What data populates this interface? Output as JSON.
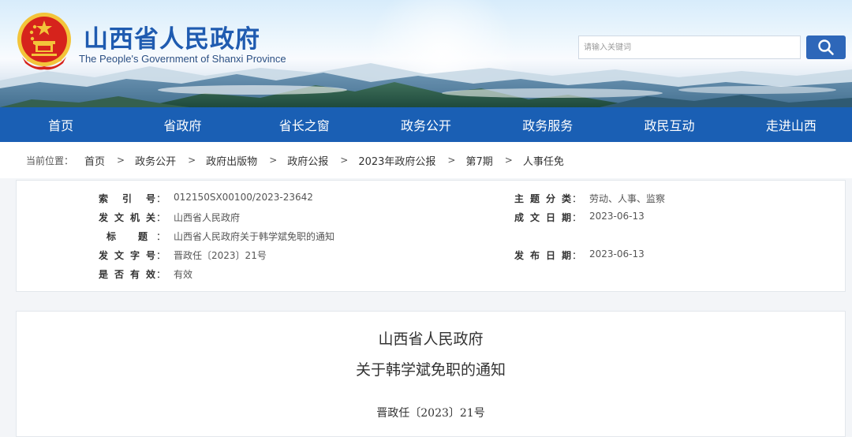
{
  "header": {
    "title": "山西省人民政府",
    "subtitle": "The People's Government of Shanxi Province",
    "search_placeholder": "请输入关键词"
  },
  "nav": {
    "items": [
      {
        "label": "首页"
      },
      {
        "label": "省政府"
      },
      {
        "label": "省长之窗"
      },
      {
        "label": "政务公开"
      },
      {
        "label": "政务服务"
      },
      {
        "label": "政民互动"
      },
      {
        "label": "走进山西"
      }
    ]
  },
  "breadcrumb": {
    "lead": "当前位置：",
    "items": [
      "首页",
      "政务公开",
      "政府出版物",
      "政府公报",
      "2023年政府公报",
      "第7期",
      "人事任免"
    ],
    "separator": ">"
  },
  "info": {
    "index_label": "索引号",
    "index_value": "012150SX00100/2023-23642",
    "issuer_label": "发文机关",
    "issuer_value": "山西省人民政府",
    "title_label": "标题",
    "title_value": "山西省人民政府关于韩学斌免职的通知",
    "docno_label": "发文字号",
    "docno_value": "晋政任〔2023〕21号",
    "valid_label": "是否有效",
    "valid_value": "有效",
    "topic_label": "主题分类",
    "topic_value": "劳动、人事、监察",
    "created_label": "成文日期",
    "created_value": "2023-06-13",
    "published_label": "发布日期",
    "published_value": "2023-06-13"
  },
  "document": {
    "title_line1": "山西省人民政府",
    "title_line2": "关于韩学斌免职的通知",
    "number": "晋政任〔2023〕21号"
  },
  "colors": {
    "nav_bg": "#1a5fb4",
    "title_blue": "#1f5bb0",
    "search_button": "#2e67b9",
    "emblem_red": "#d6231c",
    "emblem_gold": "#f3c43a"
  }
}
